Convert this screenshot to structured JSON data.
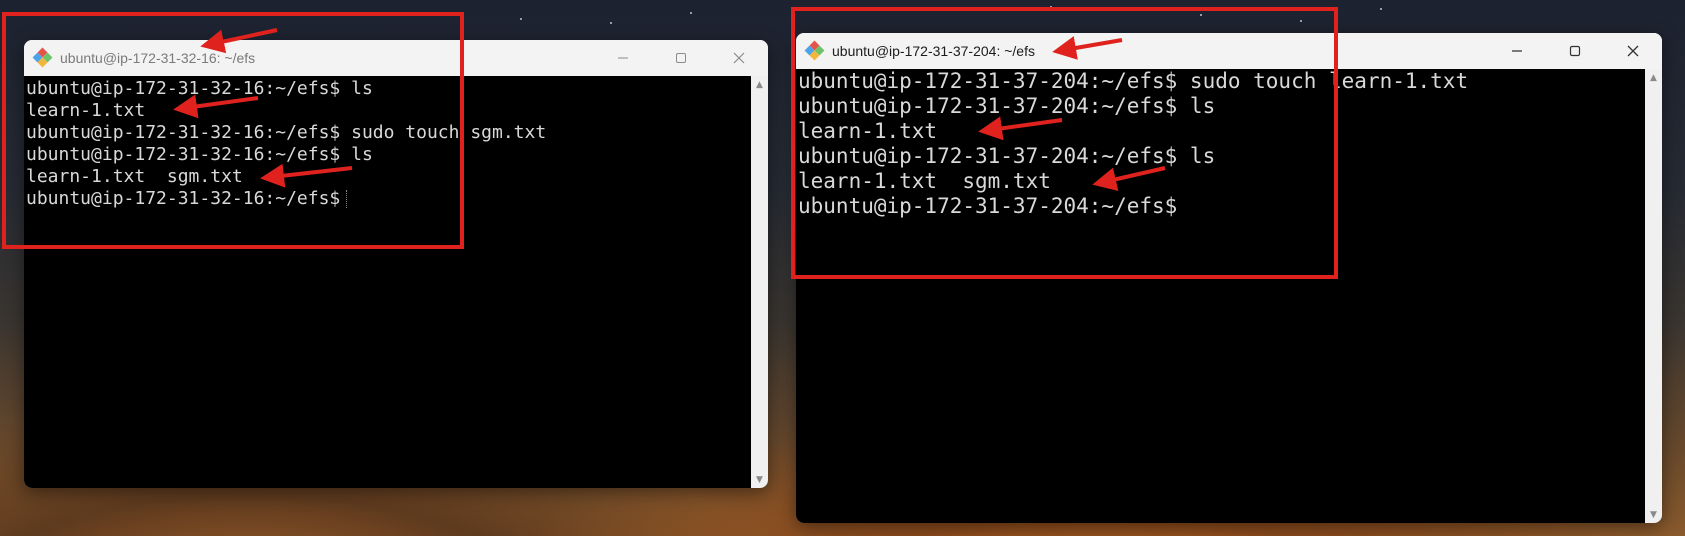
{
  "windows": [
    {
      "title": "ubuntu@ip-172-31-32-16: ~/efs",
      "lines": [
        "ubuntu@ip-172-31-32-16:~/efs$ ls",
        "learn-1.txt",
        "ubuntu@ip-172-31-32-16:~/efs$ sudo touch sgm.txt",
        "ubuntu@ip-172-31-32-16:~/efs$ ls",
        "learn-1.txt  sgm.txt",
        "ubuntu@ip-172-31-32-16:~/efs$"
      ]
    },
    {
      "title": "ubuntu@ip-172-31-37-204: ~/efs",
      "lines": [
        "ubuntu@ip-172-31-37-204:~/efs$ sudo touch learn-1.txt",
        "ubuntu@ip-172-31-37-204:~/efs$ ls",
        "learn-1.txt",
        "ubuntu@ip-172-31-37-204:~/efs$ ls",
        "learn-1.txt  sgm.txt",
        "ubuntu@ip-172-31-37-204:~/efs$"
      ]
    }
  ],
  "icons": {
    "app": "git-bash-diamond-icon",
    "minimize": "minimize-icon",
    "maximize": "maximize-icon",
    "close": "close-icon"
  },
  "colors": {
    "annotation": "#e0221f",
    "terminal_bg": "#000000",
    "terminal_fg": "#d9d9d9"
  }
}
